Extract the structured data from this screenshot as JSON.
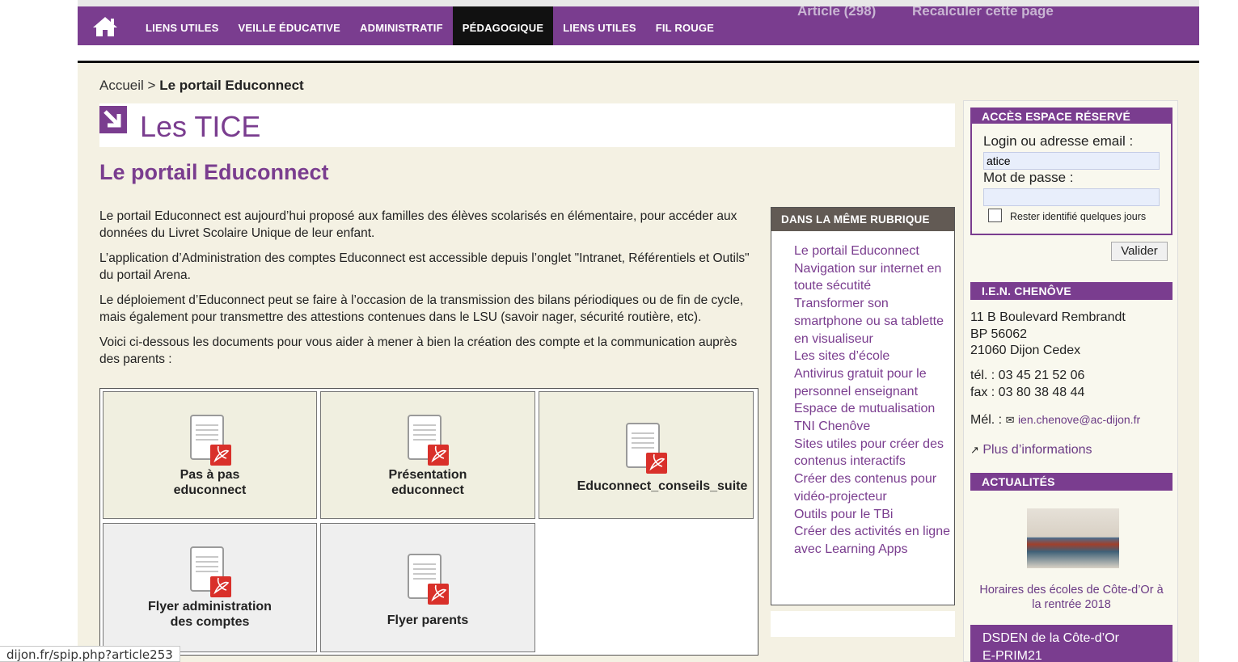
{
  "nav": {
    "items": [
      "LIENS UTILES",
      "VEILLE ÉDUCATIVE",
      "ADMINISTRATIF",
      "PÉDAGOGIQUE",
      "LIENS UTILES",
      "FIL ROUGE"
    ],
    "active_index": 3,
    "ghost_article": "Article (298)",
    "ghost_recalc": "Recalculer cette page"
  },
  "breadcrumb": {
    "home": "Accueil",
    "sep": " > ",
    "current": "Le portail Educonnect"
  },
  "section_title": "Les TICE",
  "article": {
    "title": "Le portail Educonnect",
    "paragraphs": [
      "Le portail Educonnect est aujourd’hui proposé aux familles des élèves scolarisés en élémentaire, pour accéder aux données du Livret Scolaire Unique de leur enfant.",
      "L’application d’Administration des comptes Educonnect est accessible depuis l’onglet \"Intranet, Référentiels et Outils\" du portail Arena.",
      "Le déploiement d’Educonnect peut se faire à l’occasion de la transmission des bilans périodiques ou de fin de cycle, mais également pour transmettre des attestions contenues dans le LSU (savoir nager, sécurité routière, etc).",
      "Voici ci-dessous les documents pour vous aider à mener à bien la création des compte et la communication auprès des parents :"
    ]
  },
  "documents": [
    {
      "line1": "Pas à pas",
      "line2": "educonnect",
      "icon": "pdf-icon"
    },
    {
      "line1": "Présentation",
      "line2": "educonnect",
      "icon": "pdf-icon"
    },
    {
      "line1": "Educonnect_conseils_suite",
      "line2": "",
      "icon": "pdf-icon"
    },
    {
      "line1": "Flyer administration",
      "line2": "des comptes",
      "icon": "pdf-icon"
    },
    {
      "line1": "Flyer parents",
      "line2": "",
      "icon": "pdf-icon"
    }
  ],
  "rubrique": {
    "heading": "DANS LA MÊME RUBRIQUE",
    "links": [
      "Le portail Educonnect",
      "Navigation sur internet en toute sécutité",
      "Transformer son smartphone ou sa tablette en visualiseur",
      "Les sites d’école",
      "Antivirus gratuit pour le personnel enseignant",
      "Espace de mutualisation TNI Chenôve",
      "Sites utiles pour créer des contenus interactifs",
      "Créer des contenus pour vidéo-projecteur",
      "Outils pour le TBi",
      "Créer des activités en ligne avec Learning Apps"
    ]
  },
  "login": {
    "heading": "ACCÈS ESPACE RÉSERVÉ",
    "login_label": "Login ou adresse email :",
    "login_value": "atice",
    "password_label": "Mot de passe :",
    "password_value": "",
    "remember_label": "Rester identifié quelques jours",
    "submit_label": "Valider"
  },
  "ien": {
    "heading": "I.E.N. CHENÔVE",
    "address1": "11 B Boulevard Rembrandt",
    "address2": "BP 56062",
    "address3": "21060 Dijon Cedex",
    "tel": "tél. : 03 45 21 52 06",
    "fax": "fax : 03 80 38 48 44",
    "mel_label": "Mél. :",
    "email": "ien.chenove@ac-dijon.fr",
    "more": "Plus d’informations"
  },
  "actualites": {
    "heading": "ACTUALITÉS",
    "caption": "Horaires des écoles de Côte-d’Or à la rentrée 2018"
  },
  "dsden": {
    "line1": "DSDEN de la Côte-d’Or",
    "line2": "E-PRIM21"
  },
  "status_url": "dijon.fr/spip.php?article253",
  "colors": {
    "brand": "#7a3d8f",
    "nav_active": "#111111",
    "rubrique_header": "#625a54",
    "page_bg": "#f4f1e3"
  }
}
